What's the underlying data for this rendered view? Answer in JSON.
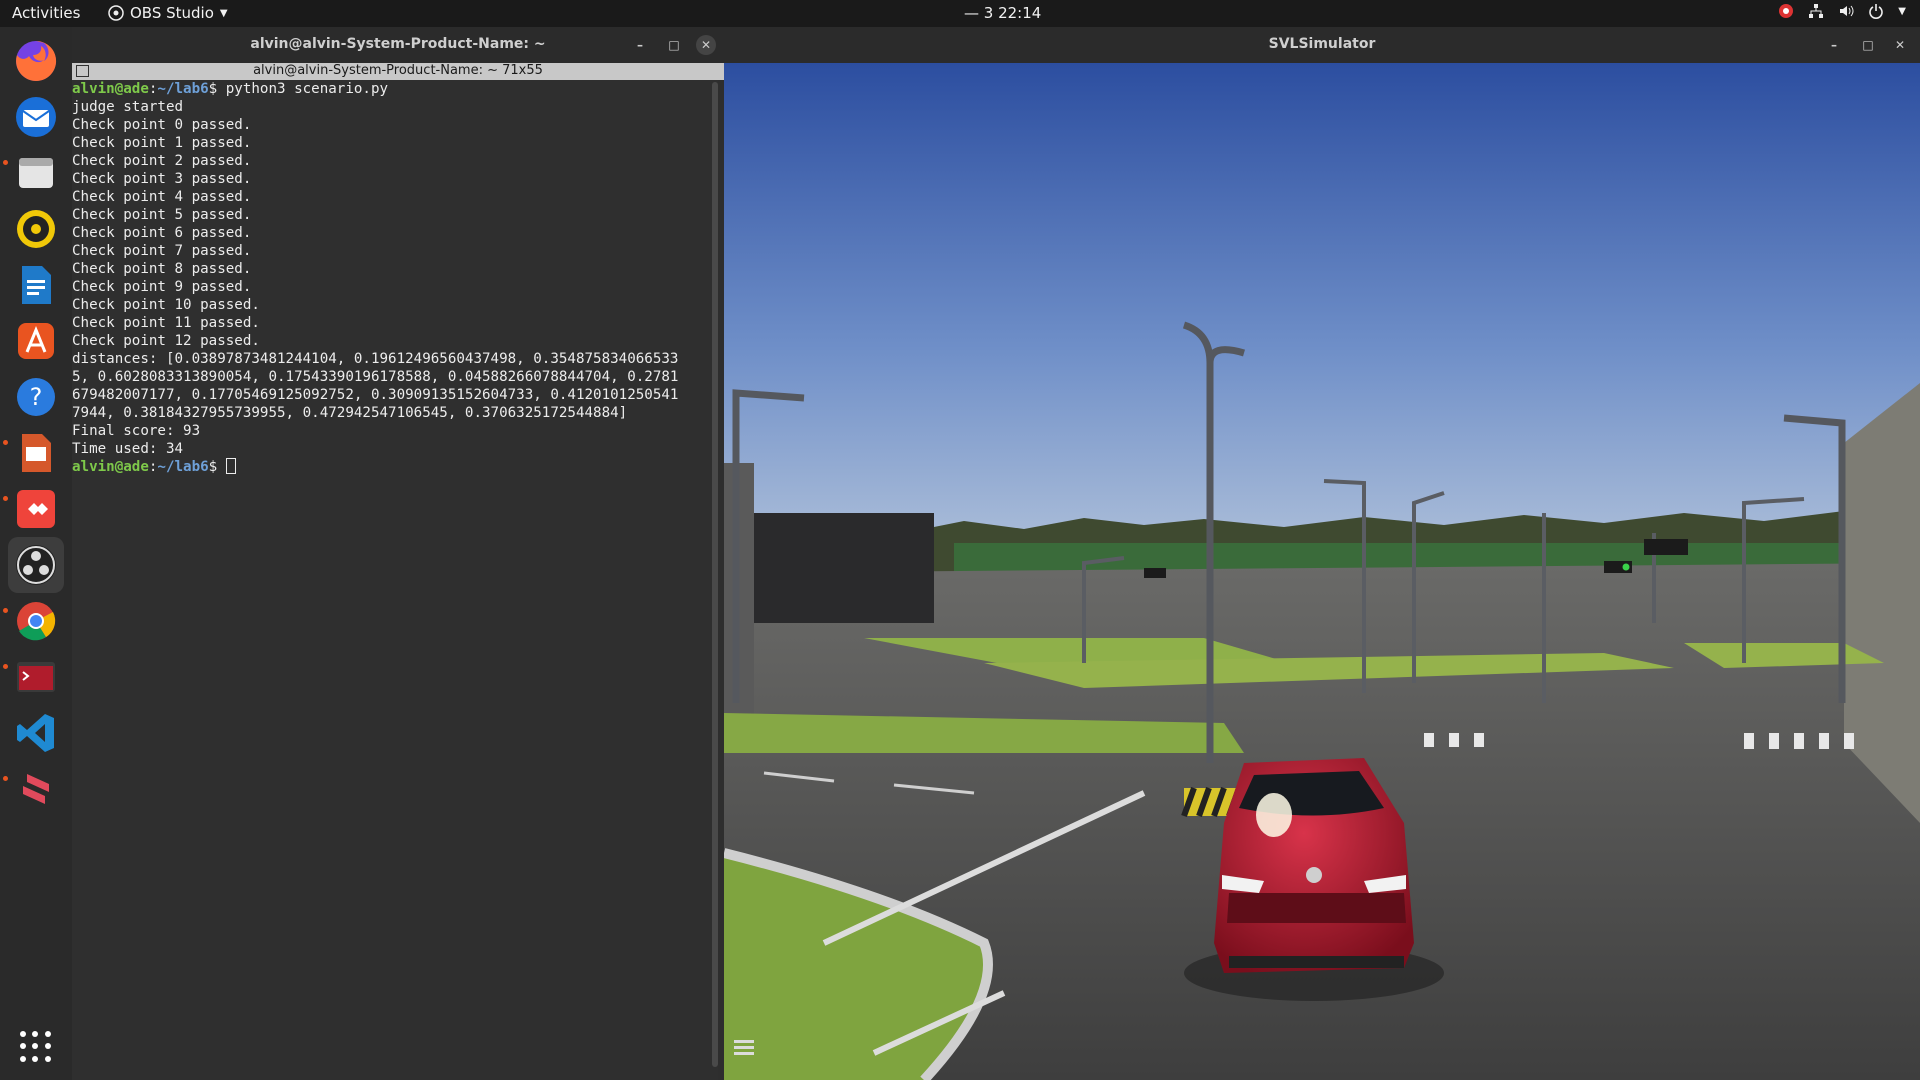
{
  "topbar": {
    "activities": "Activities",
    "app_name": "OBS Studio",
    "clock": "— 3  22:14",
    "tray_icons": [
      "obs-tray-icon",
      "network-icon",
      "volume-icon",
      "power-icon"
    ]
  },
  "dock": {
    "apps": [
      "firefox",
      "thunderbird",
      "files",
      "rhythmbox",
      "libreoffice-writer",
      "ubuntu-software",
      "help",
      "libreoffice-impress",
      "anydesk",
      "obs-studio",
      "chrome",
      "terminal-app",
      "vscode",
      "sublime-merge"
    ],
    "active": "obs-studio"
  },
  "terminal": {
    "window_title": "alvin@alvin-System-Product-Name: ~",
    "tab_title": "alvin@alvin-System-Product-Name: ~ 71x55",
    "prompt_user": "alvin@ade",
    "prompt_path": "~/lab6",
    "command": "python3 scenario.py",
    "output": [
      "judge started",
      "Check point 0 passed.",
      "Check point 1 passed.",
      "Check point 2 passed.",
      "Check point 3 passed.",
      "Check point 4 passed.",
      "Check point 5 passed.",
      "Check point 6 passed.",
      "Check point 7 passed.",
      "Check point 8 passed.",
      "Check point 9 passed.",
      "Check point 10 passed.",
      "Check point 11 passed.",
      "Check point 12 passed.",
      "distances: [0.03897873481244104, 0.19612496560437498, 0.354875834066533",
      "5, 0.6028083313890054, 0.17543390196178588, 0.045882660788447​04, 0.2781",
      "679482007177, 0.17705469125092752, 0.30909135152604733, 0.4120101250541",
      "7944, 0.38184327955739955, 0.472942547106545, 0.3706325172544884]",
      "Final score: 93",
      "Time used: 34"
    ]
  },
  "simulator": {
    "window_title": "SVLSimulator",
    "colors": {
      "sky_top": "#2c4ea0",
      "sky_bottom": "#a7bbd8",
      "road": "#4a4a4a",
      "grass": "#6b9b3a",
      "car": "#a3162a"
    }
  }
}
